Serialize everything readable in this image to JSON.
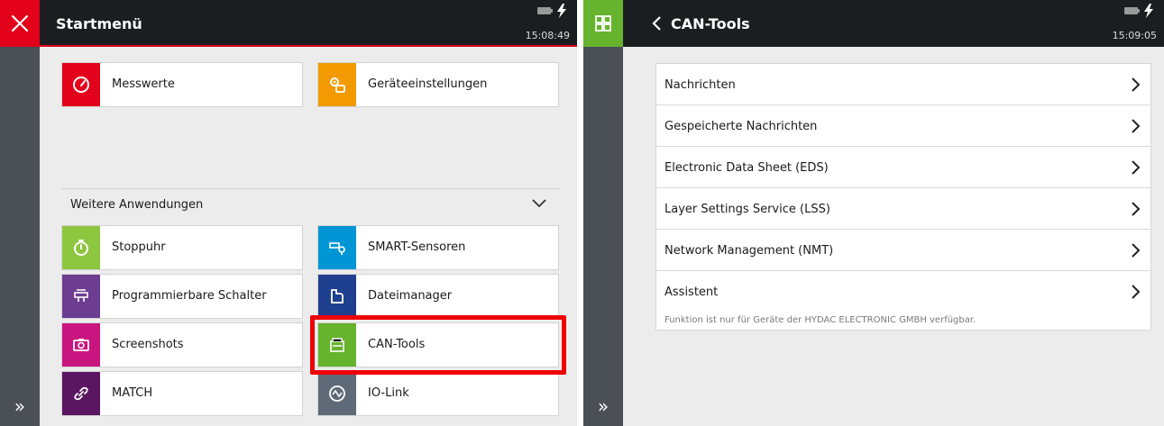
{
  "left_screen": {
    "title": "Startmenü",
    "clock": "15:08:49",
    "corner_icon": "close-icon",
    "tiles_top": [
      {
        "label": "Messwerte",
        "icon": "gauge-icon",
        "color": "#e2001a"
      },
      {
        "label": "Geräteeinstellungen",
        "icon": "settings-gears-icon",
        "color": "#f39a00"
      }
    ],
    "section": {
      "label": "Weitere Anwendungen",
      "icon": "chevron-down-icon"
    },
    "tiles_more": [
      {
        "label": "Stoppuhr",
        "icon": "stopwatch-icon",
        "color": "#8dc63f"
      },
      {
        "label": "SMART-Sensoren",
        "icon": "smart-sensor-icon",
        "color": "#0096d6"
      },
      {
        "label": "Programmierbare Schalter",
        "icon": "programmable-switch-icon",
        "color": "#6c3d91"
      },
      {
        "label": "Dateimanager",
        "icon": "file-manager-icon",
        "color": "#1f3f8f"
      },
      {
        "label": "Screenshots",
        "icon": "camera-icon",
        "color": "#c9157f"
      },
      {
        "label": "CAN-Tools",
        "icon": "can-tools-icon",
        "color": "#66b32e"
      },
      {
        "label": "MATCH",
        "icon": "link-icon",
        "color": "#5a1660"
      },
      {
        "label": "IO-Link",
        "icon": "io-link-icon",
        "color": "#5f6a78"
      }
    ],
    "highlighted_tile": "CAN-Tools",
    "sidebar_expand": "»"
  },
  "right_screen": {
    "title": "CAN-Tools",
    "clock": "15:09:05",
    "corner_icon": "apps-grid-icon",
    "back_icon": "chevron-left-icon",
    "menu_items": [
      {
        "label": "Nachrichten"
      },
      {
        "label": "Gespeicherte Nachrichten"
      },
      {
        "label": "Electronic Data Sheet (EDS)"
      },
      {
        "label": "Layer Settings Service (LSS)"
      },
      {
        "label": "Network Management (NMT)"
      },
      {
        "label": "Assistent"
      }
    ],
    "note": "Funktion ist nur für Geräte der HYDAC ELECTRONIC GMBH verfügbar.",
    "sidebar_expand": "»"
  },
  "colors": {
    "topbar": "#1c1d20",
    "sidebar": "#4b4f56",
    "content": "#ececec",
    "accent_red": "#e2001a",
    "accent_green": "#66b32e",
    "highlight": "#ee0000"
  }
}
